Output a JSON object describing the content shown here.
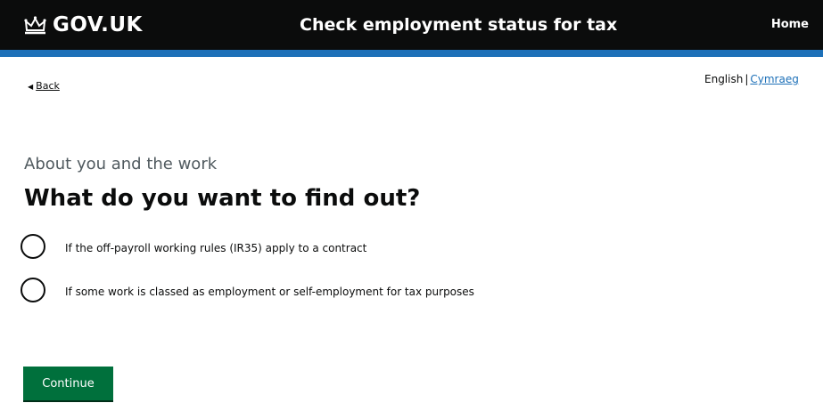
{
  "header": {
    "logo_text": "GOV.UK",
    "logo_icon": "crown-icon",
    "service_name": "Check employment status for tax",
    "nav_home": "Home"
  },
  "colors": {
    "header_bg": "#0b0c0c",
    "header_rule": "#1d70b8",
    "button_green": "#00703c",
    "link_blue": "#1d70b8",
    "caption_grey": "#505a5f"
  },
  "back_link": "Back",
  "back_icon": "triangle-left-icon",
  "language": {
    "english": "English",
    "separator": "|",
    "welsh": "Cymraeg"
  },
  "question": {
    "caption": "About you and the work",
    "heading": "What do you want to find out?",
    "options": [
      {
        "label": "If the off-payroll working rules (IR35) apply to a contract",
        "selected": false
      },
      {
        "label": "If some work is classed as employment or self-employment for tax purposes",
        "selected": false
      }
    ]
  },
  "continue_button": "Continue"
}
